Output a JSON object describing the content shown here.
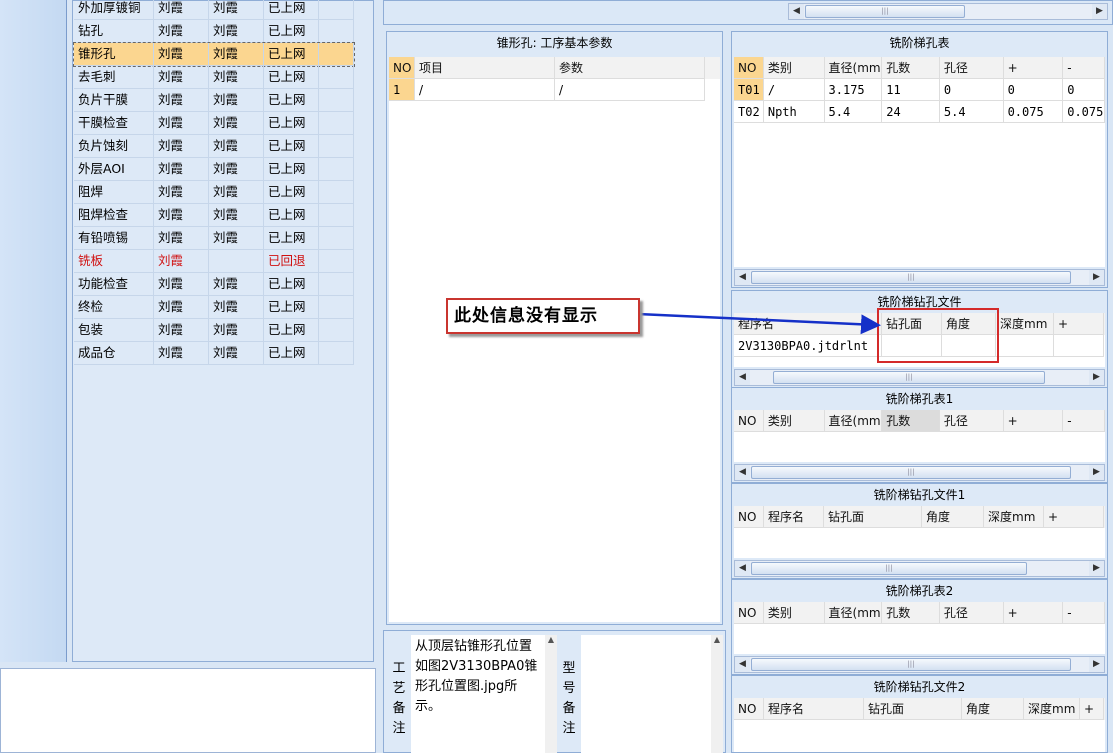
{
  "process_list": [
    {
      "name": "外加厚镀铜",
      "c1": "刘霞",
      "c2": "刘霞",
      "status": "已上网",
      "selected": false,
      "red": false
    },
    {
      "name": "钻孔",
      "c1": "刘霞",
      "c2": "刘霞",
      "status": "已上网",
      "selected": false,
      "red": false
    },
    {
      "name": "锥形孔",
      "c1": "刘霞",
      "c2": "刘霞",
      "status": "已上网",
      "selected": true,
      "red": false
    },
    {
      "name": "去毛刺",
      "c1": "刘霞",
      "c2": "刘霞",
      "status": "已上网",
      "selected": false,
      "red": false
    },
    {
      "name": "负片干膜",
      "c1": "刘霞",
      "c2": "刘霞",
      "status": "已上网",
      "selected": false,
      "red": false
    },
    {
      "name": "干膜检查",
      "c1": "刘霞",
      "c2": "刘霞",
      "status": "已上网",
      "selected": false,
      "red": false
    },
    {
      "name": "负片蚀刻",
      "c1": "刘霞",
      "c2": "刘霞",
      "status": "已上网",
      "selected": false,
      "red": false
    },
    {
      "name": "外层AOI",
      "c1": "刘霞",
      "c2": "刘霞",
      "status": "已上网",
      "selected": false,
      "red": false
    },
    {
      "name": "阻焊",
      "c1": "刘霞",
      "c2": "刘霞",
      "status": "已上网",
      "selected": false,
      "red": false
    },
    {
      "name": "阻焊检查",
      "c1": "刘霞",
      "c2": "刘霞",
      "status": "已上网",
      "selected": false,
      "red": false
    },
    {
      "name": "有铅喷锡",
      "c1": "刘霞",
      "c2": "刘霞",
      "status": "已上网",
      "selected": false,
      "red": false
    },
    {
      "name": "铣板",
      "c1": "刘霞",
      "c2": "",
      "status": "已回退",
      "selected": false,
      "red": true
    },
    {
      "name": "功能检查",
      "c1": "刘霞",
      "c2": "刘霞",
      "status": "已上网",
      "selected": false,
      "red": false
    },
    {
      "name": "终检",
      "c1": "刘霞",
      "c2": "刘霞",
      "status": "已上网",
      "selected": false,
      "red": false
    },
    {
      "name": "包装",
      "c1": "刘霞",
      "c2": "刘霞",
      "status": "已上网",
      "selected": false,
      "red": false
    },
    {
      "name": "成品仓",
      "c1": "刘霞",
      "c2": "刘霞",
      "status": "已上网",
      "selected": false,
      "red": false
    }
  ],
  "basic_params": {
    "title": "锥形孔: 工序基本参数",
    "headers": [
      "NO",
      "项目",
      "参数"
    ],
    "rows": [
      [
        "1",
        "/",
        "/"
      ]
    ]
  },
  "step_hole_table": {
    "title": "铣阶梯孔表",
    "headers": [
      "NO",
      "类别",
      "直径(mm)",
      "孔数",
      "孔径",
      "+",
      "-"
    ],
    "rows": [
      [
        "T01",
        "/",
        "3.175",
        "11",
        "0",
        "0",
        "0"
      ],
      [
        "T02",
        "Npth",
        "5.4",
        "24",
        "5.4",
        "0.075",
        "0.075"
      ]
    ]
  },
  "step_drill_file": {
    "title": "铣阶梯钻孔文件",
    "headers": [
      "程序名",
      "钻孔面",
      "角度",
      "深度mm",
      "+"
    ],
    "rows": [
      [
        "2V3130BPA0.jtdrlnt",
        "",
        "",
        "",
        ""
      ]
    ]
  },
  "step_hole_table1": {
    "title": "铣阶梯孔表1",
    "headers": [
      "NO",
      "类别",
      "直径(mm)",
      "孔数",
      "孔径",
      "+",
      "-"
    ]
  },
  "step_drill_file1": {
    "title": "铣阶梯钻孔文件1",
    "headers": [
      "NO",
      "程序名",
      "钻孔面",
      "角度",
      "深度mm",
      "+"
    ]
  },
  "step_hole_table2": {
    "title": "铣阶梯孔表2",
    "headers": [
      "NO",
      "类别",
      "直径(mm)",
      "孔数",
      "孔径",
      "+",
      "-"
    ]
  },
  "step_drill_file2": {
    "title": "铣阶梯钻孔文件2",
    "headers": [
      "NO",
      "程序名",
      "钻孔面",
      "角度",
      "深度mm",
      "+"
    ]
  },
  "annotation": {
    "callout": "此处信息没有显示"
  },
  "notes": {
    "process_label": [
      "工",
      "艺",
      "备",
      "注"
    ],
    "process_text": "从顶层钻锥形孔位置如图2V3130BPA0锥形孔位置图.jpg所示。",
    "model_label": [
      "型",
      "号",
      "备",
      "注"
    ],
    "model_text": ""
  },
  "colors": {
    "selected_row": "#fbd690",
    "annotation_red": "#d42a2a",
    "arrow_blue": "#1530c8",
    "panel_bg": "#dde9f7"
  }
}
